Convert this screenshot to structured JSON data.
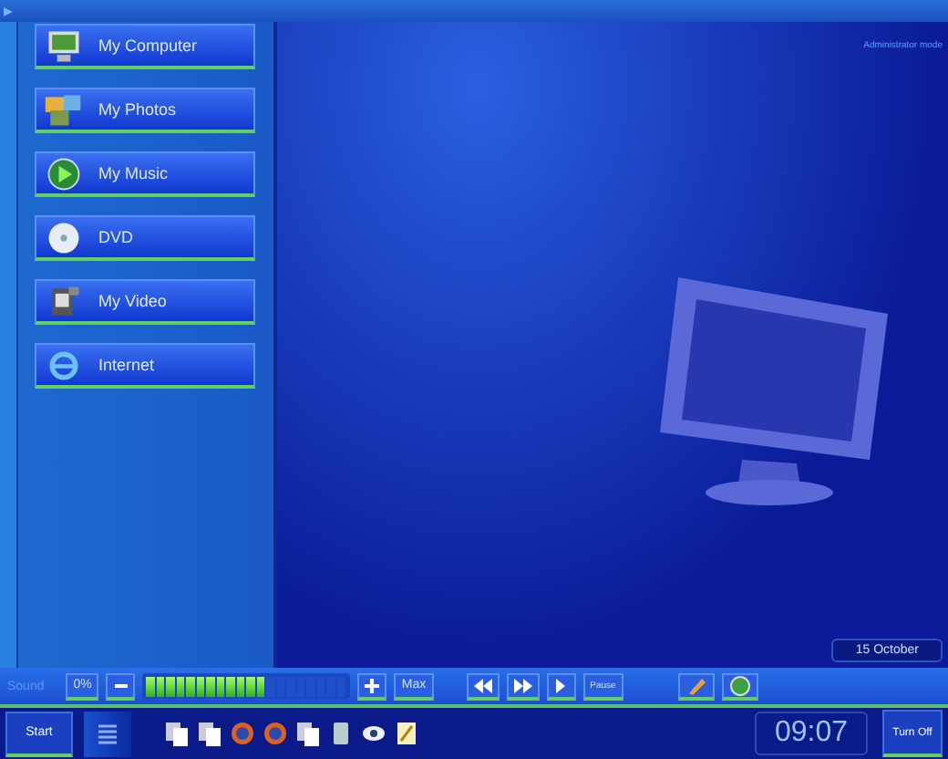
{
  "menu": [
    {
      "label": "My Computer",
      "kind": "computer"
    },
    {
      "label": "My Photos",
      "kind": "photos"
    },
    {
      "label": "My Music",
      "kind": "music"
    },
    {
      "label": "DVD",
      "kind": "disc"
    },
    {
      "label": "My Video",
      "kind": "video"
    },
    {
      "label": "Internet",
      "kind": "internet"
    }
  ],
  "status_line": "Administrator mode",
  "date": "15 October",
  "sound": {
    "label": "Sound",
    "min_button": "0%",
    "level": 0.6,
    "max_button": "Max"
  },
  "media": {
    "pause_button": "Pause"
  },
  "taskbar": {
    "start_button": "Start",
    "clock": "09:07",
    "turn_off_button": "Turn Off",
    "apps": [
      {
        "kind": "document"
      },
      {
        "kind": "document"
      },
      {
        "kind": "globe"
      },
      {
        "kind": "globe"
      },
      {
        "kind": "document"
      },
      {
        "kind": "device"
      },
      {
        "kind": "eye"
      },
      {
        "kind": "notepad"
      }
    ]
  }
}
